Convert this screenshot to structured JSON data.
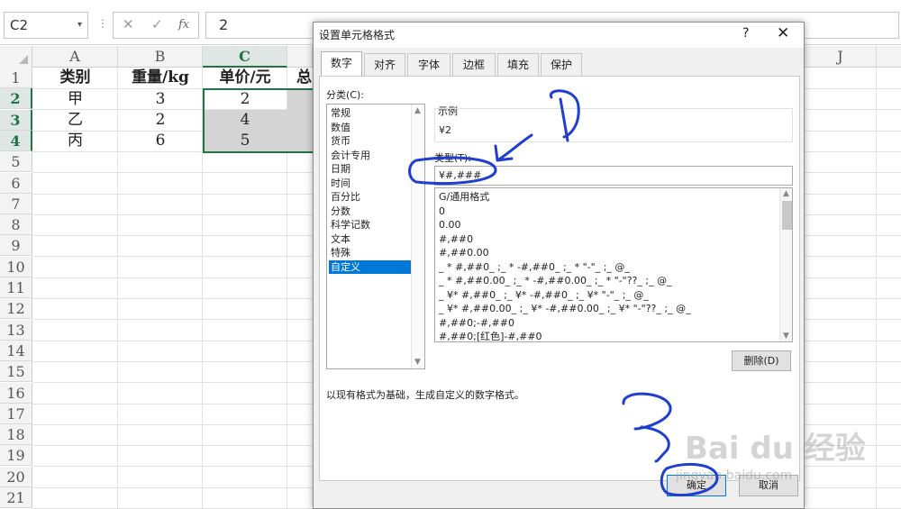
{
  "formula_bar": {
    "name_box": "C2",
    "name_dropdown": "▾",
    "separator": "⋮",
    "cancel_glyph": "✕",
    "enter_glyph": "✓",
    "fx_glyph": "fx",
    "formula": "2"
  },
  "sheet": {
    "columns": [
      "A",
      "B",
      "C",
      "J"
    ],
    "row_numbers": [
      "1",
      "2",
      "3",
      "4",
      "5",
      "6",
      "7",
      "8",
      "9",
      "10",
      "11",
      "12",
      "13",
      "14",
      "15",
      "16",
      "17",
      "18",
      "19",
      "20",
      "21"
    ],
    "headers": [
      "类别",
      "重量/kg",
      "单价/元",
      "总"
    ],
    "rows": [
      {
        "category": "甲",
        "weight": "3",
        "price": "2"
      },
      {
        "category": "乙",
        "weight": "2",
        "price": "4"
      },
      {
        "category": "丙",
        "weight": "6",
        "price": "5"
      }
    ],
    "selection_color": "#217346"
  },
  "dialog": {
    "title": "设置单元格格式",
    "help": "?",
    "close": "✕",
    "tabs": [
      "数字",
      "对齐",
      "字体",
      "边框",
      "填充",
      "保护"
    ],
    "active_tab": "数字",
    "category_label": "分类(C):",
    "categories": [
      "常规",
      "数值",
      "货币",
      "会计专用",
      "日期",
      "时间",
      "百分比",
      "分数",
      "科学记数",
      "文本",
      "特殊",
      "自定义"
    ],
    "selected_category": "自定义",
    "sample_label": "示例",
    "sample_value": "¥2",
    "type_label": "类型(T):",
    "type_value": "¥#,###",
    "formats": [
      "G/通用格式",
      "0",
      "0.00",
      "#,##0",
      "#,##0.00",
      "_ * #,##0_ ;_ * -#,##0_ ;_ * \"-\"_ ;_ @_",
      "_ * #,##0.00_ ;_ * -#,##0.00_ ;_ * \"-\"??_ ;_ @_",
      "_ ¥* #,##0_ ;_ ¥* -#,##0_ ;_ ¥* \"-\"_ ;_ @_",
      "_ ¥* #,##0.00_ ;_ ¥* -#,##0.00_ ;_ ¥* \"-\"??_ ;_ @_",
      "#,##0;-#,##0",
      "#,##0;[红色]-#,##0"
    ],
    "delete_label": "删除(D)",
    "description": "以现有格式为基础，生成自定义的数字格式。",
    "ok_label": "确定",
    "cancel_label": "取消",
    "accent": "#0078d7"
  },
  "watermark": {
    "logo": "Bai du 经验",
    "url": "jingyan.baidu.com"
  },
  "annotations": {
    "color": "#1f3fd0",
    "labels": [
      "1",
      "2",
      "3"
    ]
  }
}
